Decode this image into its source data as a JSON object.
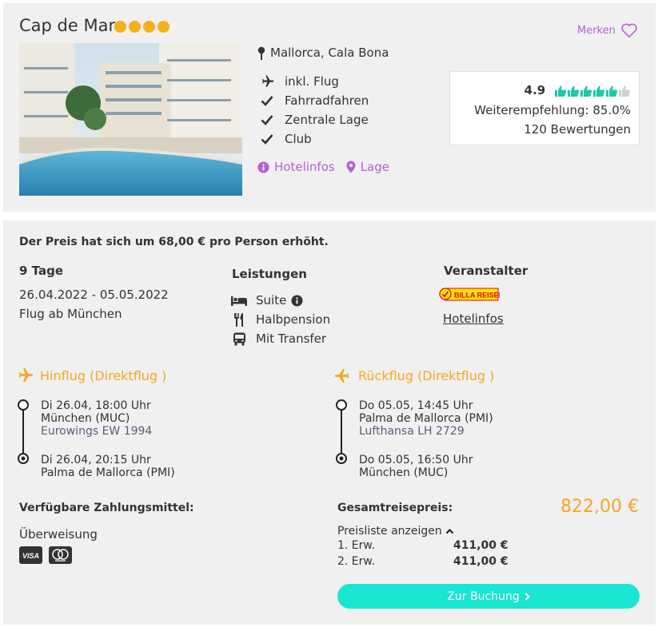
{
  "hotel": {
    "name": "Cap de Mar",
    "star_count": 4,
    "merken_label": "Merken",
    "location": "Mallorca, Cala Bona",
    "features": [
      "inkl. Flug",
      "Fahrradfahren",
      "Zentrale Lage",
      "Club"
    ],
    "links": {
      "hotelinfos": "Hotelinfos",
      "lage": "Lage"
    },
    "rating": {
      "score": "4.9",
      "thumbs_filled": 5,
      "thumbs_total": 6,
      "recommendation": "Weiterempfehlung: 85.0%",
      "reviews": "120 Bewertungen"
    }
  },
  "offer": {
    "notice": "Der Preis hat sich um 68,00 € pro Person erhöht.",
    "duration": "9 Tage",
    "dates": "26.04.2022 - 05.05.2022",
    "departure": "Flug ab München",
    "services_title": "Leistungen",
    "services": [
      "Suite",
      "Halbpension",
      "Mit Transfer"
    ],
    "operator_title": "Veranstalter",
    "operator_logo_text": "BILLA REISEN",
    "operator_link": "Hotelinfos"
  },
  "flights": {
    "outbound": {
      "title": "Hinflug (Direktflug )",
      "dep_time": "Di 26.04, 18:00 Uhr",
      "dep_airport": "München (MUC)",
      "airline": "Eurowings EW 1994",
      "arr_time": "Di 26.04, 20:15 Uhr",
      "arr_airport": "Palma de Mallorca (PMI)"
    },
    "return": {
      "title": "Rückflug (Direktflug )",
      "dep_time": "Do 05.05, 14:45 Uhr",
      "dep_airport": "Palma de Mallorca (PMI)",
      "airline": "Lufthansa LH 2729",
      "arr_time": "Do 05.05, 16:50 Uhr",
      "arr_airport": "München (MUC)"
    }
  },
  "payment": {
    "title": "Verfügbare Zahlungsmittel:",
    "method": "Überweisung",
    "cards": [
      "VISA",
      "Mastercard"
    ]
  },
  "pricing": {
    "title": "Gesamtreisepreis:",
    "total": "822,00 €",
    "toggle": "Preisliste anzeigen",
    "rows": [
      {
        "label": "1. Erw.",
        "value": "411,00 €"
      },
      {
        "label": "2. Erw.",
        "value": "411,00 €"
      }
    ],
    "book_button": "Zur Buchung"
  },
  "colors": {
    "accent_purple": "#b65fd6",
    "accent_orange": "#f5a623",
    "star": "#f5b01b",
    "rating_green": "#1fc9a8",
    "button": "#19e6d0"
  }
}
